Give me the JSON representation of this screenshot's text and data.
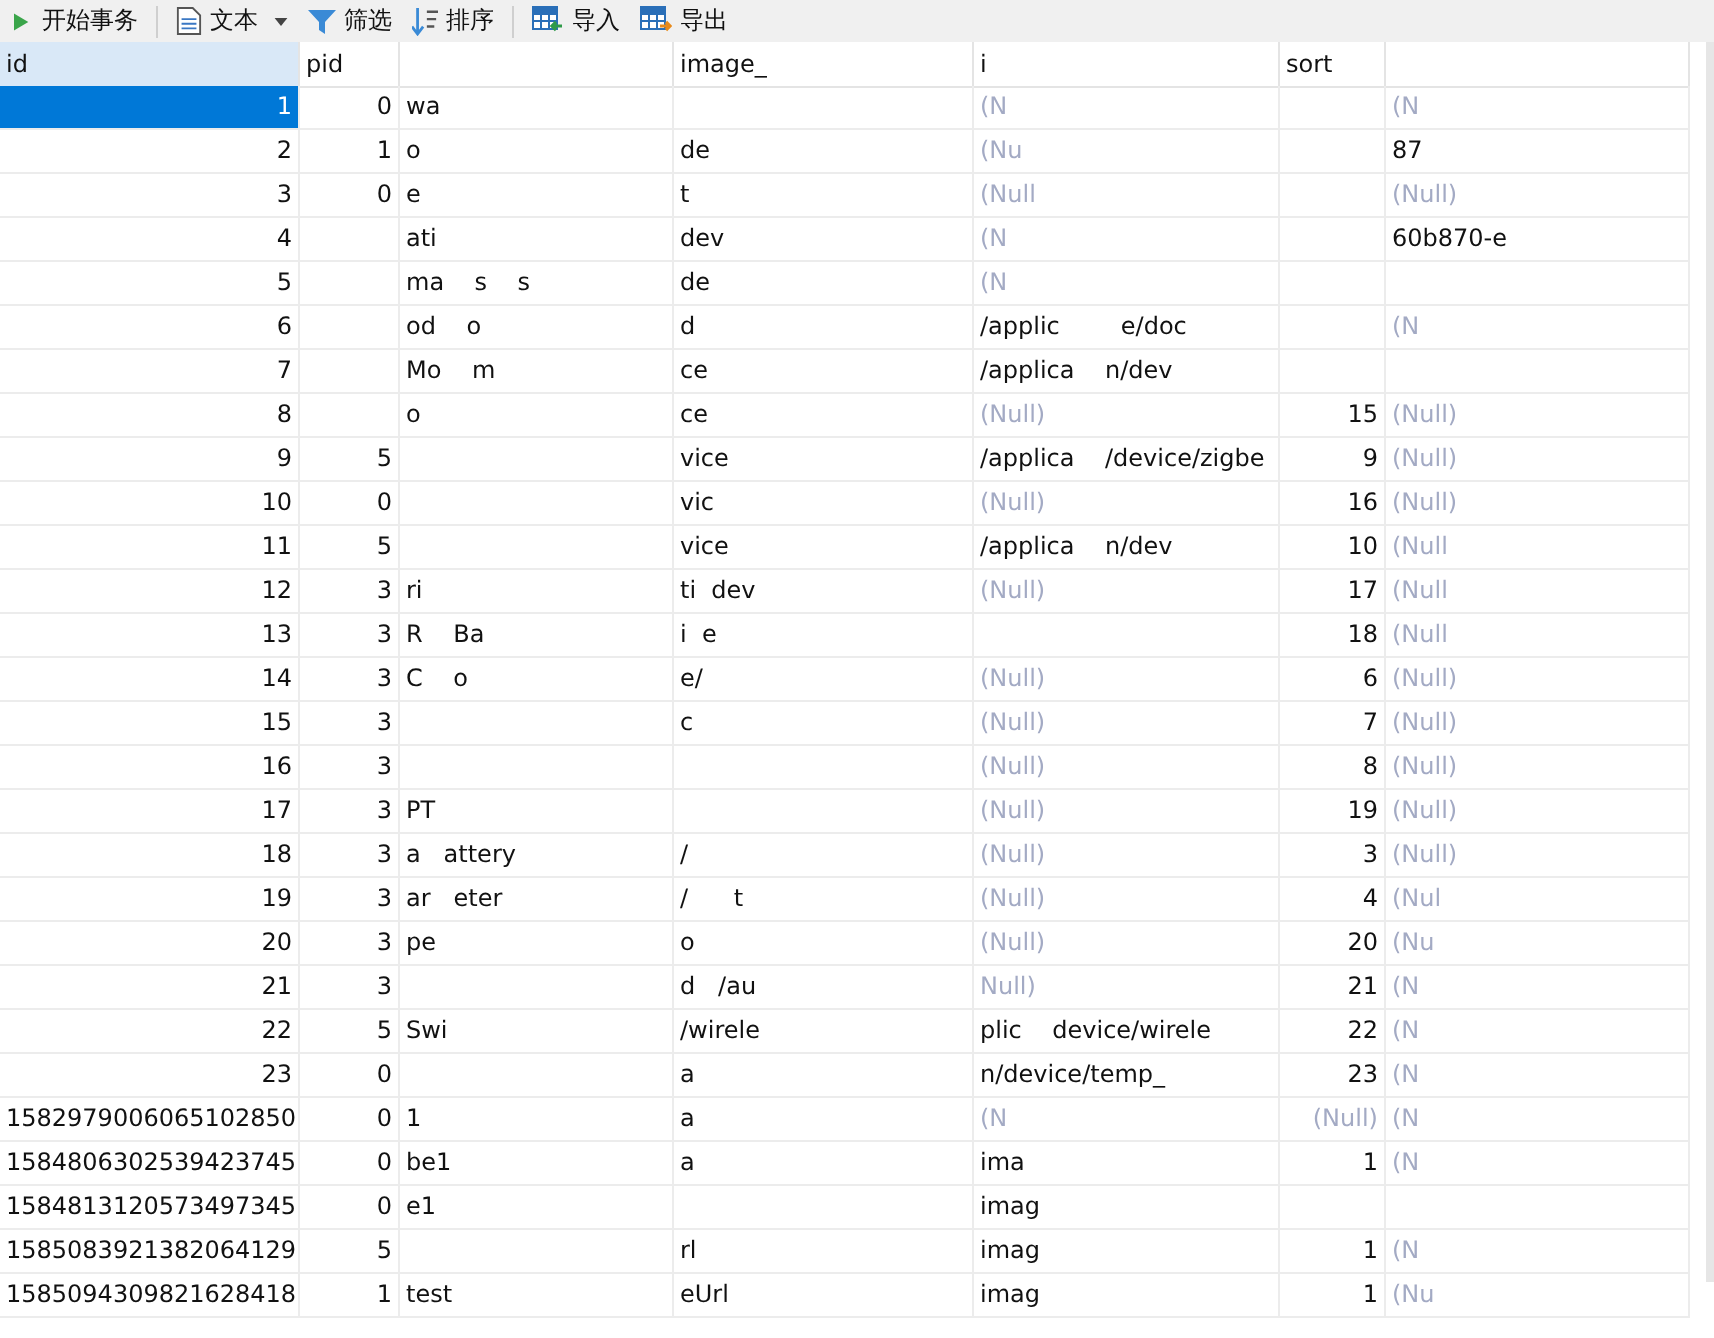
{
  "toolbar": [
    {
      "kind": "transaction",
      "label": "开始事务"
    },
    {
      "kind": "text",
      "label": "文本"
    },
    {
      "kind": "filter",
      "label": "筛选"
    },
    {
      "kind": "sort",
      "label": "排序"
    },
    {
      "kind": "import",
      "label": "导入"
    },
    {
      "kind": "export",
      "label": "导出"
    }
  ],
  "table": {
    "columns": [
      {
        "label": "id",
        "kind": "number",
        "selected": true
      },
      {
        "label": "pid",
        "kind": "number",
        "selected": false
      },
      {
        "kind": "text",
        "selected": false
      },
      {
        "label": "image_",
        "kind": "text",
        "selected": false
      },
      {
        "label": "i",
        "kind": "text",
        "selected": false
      },
      {
        "label": "sort",
        "kind": "number",
        "selected": false
      },
      {
        "kind": "text",
        "selected": false
      }
    ],
    "rows": [
      {
        "selected": true,
        "cells": [
          {
            "text": "1"
          },
          {
            "text": "0"
          },
          {
            "text": "wa"
          },
          null,
          {
            "text": "(N",
            "null": true
          },
          null,
          {
            "text": "(N",
            "null": true
          }
        ]
      },
      {
        "selected": false,
        "cells": [
          {
            "text": "2"
          },
          {
            "text": "1"
          },
          {
            "text": "o"
          },
          {
            "text": "de"
          },
          {
            "text": "(Nu",
            "null": true
          },
          null,
          {
            "text": "87"
          }
        ]
      },
      {
        "selected": false,
        "cells": [
          {
            "text": "3"
          },
          {
            "text": "0"
          },
          {
            "text": "e"
          },
          {
            "text": "t"
          },
          {
            "text": "(Null",
            "null": true
          },
          null,
          {
            "text": "(Null)",
            "null": true
          }
        ]
      },
      {
        "selected": false,
        "cells": [
          {
            "text": "4"
          },
          null,
          {
            "text": "ati"
          },
          {
            "text": "dev"
          },
          {
            "text": "(N",
            "null": true
          },
          null,
          {
            "text": "60b870-e"
          }
        ]
      },
      {
        "selected": false,
        "cells": [
          {
            "text": "5"
          },
          null,
          {
            "text": "ma    s    s"
          },
          {
            "text": "de"
          },
          {
            "text": "(N",
            "null": true
          },
          null,
          null
        ]
      },
      {
        "selected": false,
        "cells": [
          {
            "text": "6"
          },
          null,
          {
            "text": "od    o"
          },
          {
            "text": "d"
          },
          {
            "text": "/applic        e/doc"
          },
          null,
          {
            "text": "(N",
            "null": true
          }
        ]
      },
      {
        "selected": false,
        "cells": [
          {
            "text": "7"
          },
          null,
          {
            "text": "Mo    m"
          },
          {
            "text": "ce"
          },
          {
            "text": "/applica    n/dev"
          },
          null,
          null
        ]
      },
      {
        "selected": false,
        "cells": [
          {
            "text": "8"
          },
          null,
          {
            "text": "o"
          },
          {
            "text": "ce"
          },
          {
            "text": "(Null)",
            "null": true
          },
          {
            "text": "15"
          },
          {
            "text": "(Null)",
            "null": true
          }
        ]
      },
      {
        "selected": false,
        "cells": [
          {
            "text": "9"
          },
          {
            "text": "5"
          },
          null,
          {
            "text": "vice"
          },
          {
            "text": "/applica    /device/zigbe"
          },
          {
            "text": "9"
          },
          {
            "text": "(Null)",
            "null": true
          }
        ]
      },
      {
        "selected": false,
        "cells": [
          {
            "text": "10"
          },
          {
            "text": "0"
          },
          null,
          {
            "text": "vic"
          },
          {
            "text": "(Null)",
            "null": true
          },
          {
            "text": "16"
          },
          {
            "text": "(Null)",
            "null": true
          }
        ]
      },
      {
        "selected": false,
        "cells": [
          {
            "text": "11"
          },
          {
            "text": "5"
          },
          null,
          {
            "text": "vice"
          },
          {
            "text": "/applica    n/dev"
          },
          {
            "text": "10"
          },
          {
            "text": "(Null",
            "null": true
          }
        ]
      },
      {
        "selected": false,
        "cells": [
          {
            "text": "12"
          },
          {
            "text": "3"
          },
          {
            "text": "ri"
          },
          {
            "text": "ti  dev"
          },
          {
            "text": "(Null)",
            "null": true
          },
          {
            "text": "17"
          },
          {
            "text": "(Null",
            "null": true
          }
        ]
      },
      {
        "selected": false,
        "cells": [
          {
            "text": "13"
          },
          {
            "text": "3"
          },
          {
            "text": "R    Ba"
          },
          {
            "text": "i  e"
          },
          null,
          {
            "text": "18"
          },
          {
            "text": "(Null",
            "null": true
          }
        ]
      },
      {
        "selected": false,
        "cells": [
          {
            "text": "14"
          },
          {
            "text": "3"
          },
          {
            "text": "C    o"
          },
          {
            "text": "e/"
          },
          {
            "text": "(Null)",
            "null": true
          },
          {
            "text": "6"
          },
          {
            "text": "(Null)",
            "null": true
          }
        ]
      },
      {
        "selected": false,
        "cells": [
          {
            "text": "15"
          },
          {
            "text": "3"
          },
          null,
          {
            "text": "c"
          },
          {
            "text": "(Null)",
            "null": true
          },
          {
            "text": "7"
          },
          {
            "text": "(Null)",
            "null": true
          }
        ]
      },
      {
        "selected": false,
        "cells": [
          {
            "text": "16"
          },
          {
            "text": "3"
          },
          null,
          null,
          {
            "text": "(Null)",
            "null": true
          },
          {
            "text": "8"
          },
          {
            "text": "(Null)",
            "null": true
          }
        ]
      },
      {
        "selected": false,
        "cells": [
          {
            "text": "17"
          },
          {
            "text": "3"
          },
          {
            "text": "PT"
          },
          null,
          {
            "text": "(Null)",
            "null": true
          },
          {
            "text": "19"
          },
          {
            "text": "(Null)",
            "null": true
          }
        ]
      },
      {
        "selected": false,
        "cells": [
          {
            "text": "18"
          },
          {
            "text": "3"
          },
          {
            "text": "a   attery"
          },
          {
            "text": "/"
          },
          {
            "text": "(Null)",
            "null": true
          },
          {
            "text": "3"
          },
          {
            "text": "(Null)",
            "null": true
          }
        ]
      },
      {
        "selected": false,
        "cells": [
          {
            "text": "19"
          },
          {
            "text": "3"
          },
          {
            "text": "ar   eter"
          },
          {
            "text": "/      t"
          },
          {
            "text": "(Null)",
            "null": true
          },
          {
            "text": "4"
          },
          {
            "text": "(Nul",
            "null": true
          }
        ]
      },
      {
        "selected": false,
        "cells": [
          {
            "text": "20"
          },
          {
            "text": "3"
          },
          {
            "text": "pe"
          },
          {
            "text": "o"
          },
          {
            "text": "(Null)",
            "null": true
          },
          {
            "text": "20"
          },
          {
            "text": "(Nu",
            "null": true
          }
        ]
      },
      {
        "selected": false,
        "cells": [
          {
            "text": "21"
          },
          {
            "text": "3"
          },
          null,
          {
            "text": "d   /au"
          },
          {
            "text": "Null)",
            "null": true
          },
          {
            "text": "21"
          },
          {
            "text": "(N",
            "null": true
          }
        ]
      },
      {
        "selected": false,
        "cells": [
          {
            "text": "22"
          },
          {
            "text": "5"
          },
          {
            "text": "Swi"
          },
          {
            "text": "/wirele"
          },
          {
            "text": "plic    device/wirele"
          },
          {
            "text": "22"
          },
          {
            "text": "(N",
            "null": true
          }
        ]
      },
      {
        "selected": false,
        "cells": [
          {
            "text": "23"
          },
          {
            "text": "0"
          },
          null,
          {
            "text": "a"
          },
          {
            "text": "n/device/temp_"
          },
          {
            "text": "23"
          },
          {
            "text": "(N",
            "null": true
          }
        ]
      },
      {
        "selected": false,
        "cells": [
          {
            "text": "1582979006065102850"
          },
          {
            "text": "0"
          },
          {
            "text": "1"
          },
          {
            "text": "a"
          },
          {
            "text": "(N",
            "null": true
          },
          {
            "text": "(Null)",
            "null": true
          },
          {
            "text": "(N",
            "null": true
          }
        ]
      },
      {
        "selected": false,
        "cells": [
          {
            "text": "1584806302539423745"
          },
          {
            "text": "0"
          },
          {
            "text": "be1"
          },
          {
            "text": "a"
          },
          {
            "text": "ima"
          },
          {
            "text": "1"
          },
          {
            "text": "(N",
            "null": true
          }
        ]
      },
      {
        "selected": false,
        "cells": [
          {
            "text": "1584813120573497345"
          },
          {
            "text": "0"
          },
          {
            "text": "e1"
          },
          null,
          {
            "text": "imag"
          },
          null,
          null
        ]
      },
      {
        "selected": false,
        "cells": [
          {
            "text": "1585083921382064129"
          },
          {
            "text": "5"
          },
          null,
          {
            "text": "rl"
          },
          {
            "text": "imag"
          },
          {
            "text": "1"
          },
          {
            "text": "(N",
            "null": true
          }
        ]
      },
      {
        "selected": false,
        "cells": [
          {
            "text": "1585094309821628418"
          },
          {
            "text": "1"
          },
          {
            "text": "test"
          },
          {
            "text": "eUrl"
          },
          {
            "text": "imag"
          },
          {
            "text": "1"
          },
          {
            "text": "(Nu",
            "null": true
          }
        ]
      }
    ]
  }
}
